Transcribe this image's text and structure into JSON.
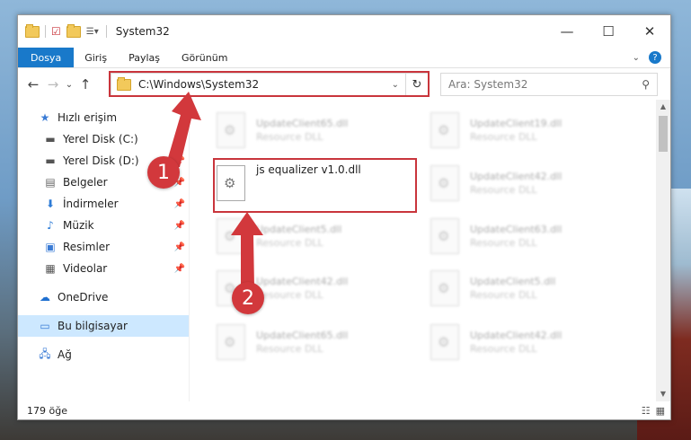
{
  "window": {
    "title": "System32",
    "controls": {
      "minimize": "—",
      "maximize": "☐",
      "close": "✕"
    }
  },
  "ribbon": {
    "tabs": [
      "Dosya",
      "Giriş",
      "Paylaş",
      "Görünüm"
    ],
    "collapse_icon": "⌄",
    "help_icon": "?"
  },
  "nav": {
    "back": "←",
    "forward": "→",
    "recent": "⌄",
    "up": "↑",
    "address": "C:\\Windows\\System32",
    "refresh": "↻",
    "search_placeholder": "Ara: System32"
  },
  "sidebar": {
    "quick_access": "Hızlı erişim",
    "items": [
      {
        "label": "Yerel Disk (C:)",
        "icon": "drive-icon"
      },
      {
        "label": "Yerel Disk (D:)",
        "icon": "drive-icon"
      },
      {
        "label": "Belgeler",
        "icon": "documents-icon"
      },
      {
        "label": "İndirmeler",
        "icon": "downloads-icon"
      },
      {
        "label": "Müzik",
        "icon": "music-icon"
      },
      {
        "label": "Resimler",
        "icon": "pictures-icon"
      },
      {
        "label": "Videolar",
        "icon": "videos-icon"
      }
    ],
    "onedrive": "OneDrive",
    "this_pc": "Bu bilgisayar",
    "network": "Ağ"
  },
  "files": {
    "left_column": [
      {
        "name": "UpdateClient65.dll",
        "type": "Resource DLL"
      },
      {
        "name": "js equalizer v1.0.dll",
        "type": ""
      },
      {
        "name": "UpdateClient5.dll",
        "type": "Resource DLL"
      },
      {
        "name": "UpdateClient42.dll",
        "type": "Resource DLL"
      },
      {
        "name": "UpdateClient65.dll",
        "type": "Resource DLL"
      }
    ],
    "right_column": [
      {
        "name": "UpdateClient19.dll",
        "type": "Resource DLL"
      },
      {
        "name": "UpdateClient42.dll",
        "type": "Resource DLL"
      },
      {
        "name": "UpdateClient63.dll",
        "type": "Resource DLL"
      },
      {
        "name": "UpdateClient5.dll",
        "type": "Resource DLL"
      },
      {
        "name": "UpdateClient42.dll",
        "type": "Resource DLL"
      }
    ]
  },
  "status": {
    "count": "179 öğe"
  },
  "annotations": {
    "step1": "1",
    "step2": "2",
    "color": "#d2383c"
  }
}
